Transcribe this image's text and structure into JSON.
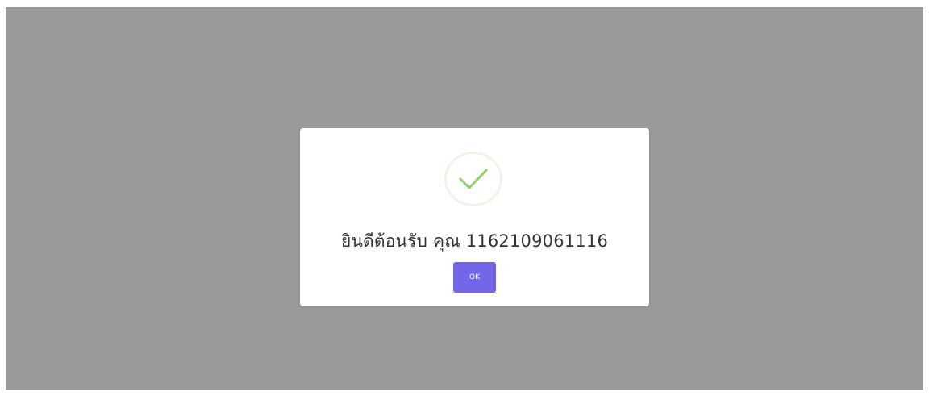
{
  "dialog": {
    "icon": "check-icon",
    "message": "ยินดีต้อนรับ คุณ 1162109061116",
    "ok_label": "OK"
  },
  "colors": {
    "overlay": "#9a9a9a",
    "modal_background": "#ffffff",
    "check": "#8fd16a",
    "ok_button": "#7366e7"
  }
}
